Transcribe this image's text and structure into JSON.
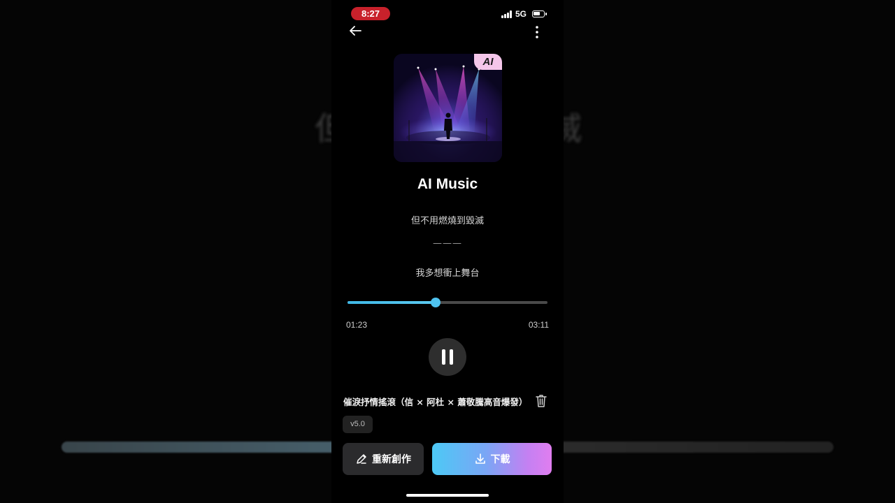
{
  "status_bar": {
    "time": "8:27",
    "network": "5G"
  },
  "background": {
    "text_left": "但",
    "text_right": "滅"
  },
  "player": {
    "ai_badge": "AI",
    "title": "AI Music",
    "lyrics": {
      "faded_previous": "...",
      "current": "但不用燃燒到毀滅",
      "separator": "———",
      "next": "我多想衝上舞台"
    },
    "progress": {
      "current_time": "01:23",
      "total_time": "03:11",
      "fraction": 0.44
    },
    "track_name": "催淚抒情搖滾（信 × 阿杜 × 蕭敬騰高音爆發）",
    "version": "v5.0"
  },
  "actions": {
    "recreate_label": "重新創作",
    "download_label": "下載"
  },
  "icons": {
    "back": "back-arrow-icon",
    "more": "more-vertical-icon",
    "pause": "pause-icon",
    "delete": "trash-icon",
    "edit": "pencil-icon",
    "download": "download-icon"
  },
  "colors": {
    "accent_blue": "#4fc3f0",
    "download_gradient_start": "#4cc9f5",
    "download_gradient_end": "#e07ef0",
    "ai_badge": "#f5c6ea",
    "time_pill": "#c8212b"
  }
}
